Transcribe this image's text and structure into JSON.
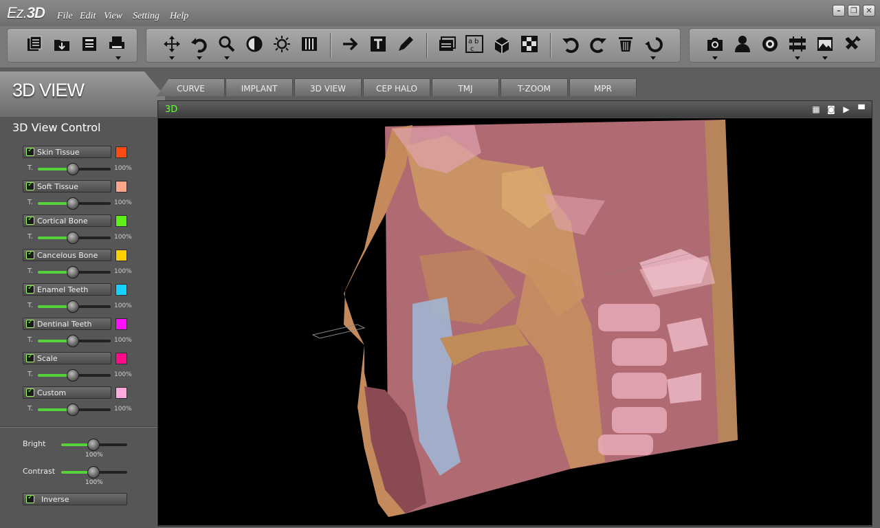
{
  "app": {
    "logo_prefix": "Ez.",
    "logo_suffix": "3D"
  },
  "menu": [
    "File",
    "Edit",
    "View",
    "Setting",
    "Help"
  ],
  "window_controls": [
    "minimize-icon",
    "restore-icon",
    "close-icon"
  ],
  "toolbar_groups": [
    [
      "open-study-icon",
      "import-folder-icon",
      "save-icon",
      "print-icon"
    ],
    [
      "pan-icon",
      "rotate-icon",
      "zoom-icon",
      "contrast-icon",
      "brightness-icon",
      "slice-icon"
    ],
    [
      "arrow-icon",
      "text-icon",
      "pencil-icon"
    ],
    [
      "report-icon",
      "ocr-icon",
      "cube-icon",
      "checker-icon"
    ],
    [
      "undo-icon",
      "redo-icon",
      "delete-icon",
      "reset-icon"
    ],
    [
      "camera-icon",
      "patient-icon",
      "disc-icon",
      "compare-icon",
      "image-icon",
      "tools-icon"
    ]
  ],
  "panel": {
    "title": "3D VIEW",
    "control_title": "3D View Control"
  },
  "tabs": [
    "CURVE",
    "IMPLANT",
    "3D VIEW",
    "CEP HALO",
    "TMJ",
    "T-ZOOM",
    "MPR"
  ],
  "layers": [
    {
      "name": "Skin Tissue",
      "color": "#ff4a12",
      "checked": true,
      "t_label": "T.",
      "value": "100%"
    },
    {
      "name": "Soft Tissue",
      "color": "#ffa68a",
      "checked": true,
      "t_label": "T.",
      "value": "100%"
    },
    {
      "name": "Cortical Bone",
      "color": "#5cf018",
      "checked": true,
      "t_label": "T.",
      "value": "100%"
    },
    {
      "name": "Cancelous Bone",
      "color": "#ffd000",
      "checked": true,
      "t_label": "T.",
      "value": "100%"
    },
    {
      "name": "Enamel Teeth",
      "color": "#14d4ff",
      "checked": true,
      "t_label": "T.",
      "value": "100%"
    },
    {
      "name": "Dentinal Teeth",
      "color": "#ff10ff",
      "checked": true,
      "t_label": "T.",
      "value": "100%"
    },
    {
      "name": "Scale",
      "color": "#ff0c8a",
      "checked": true,
      "t_label": "T.",
      "value": "100%"
    },
    {
      "name": "Custom",
      "color": "#ffaadb",
      "checked": true,
      "t_label": "T.",
      "value": "100%"
    }
  ],
  "bright": {
    "label": "Bright",
    "value": "100%"
  },
  "contrast": {
    "label": "Contrast",
    "value": "100%"
  },
  "inverse": {
    "label": "Inverse",
    "checked": true
  },
  "viewport": {
    "label": "3D",
    "controls": [
      "grid-icon",
      "snapshot-icon",
      "play-icon",
      "maximize-icon"
    ]
  }
}
